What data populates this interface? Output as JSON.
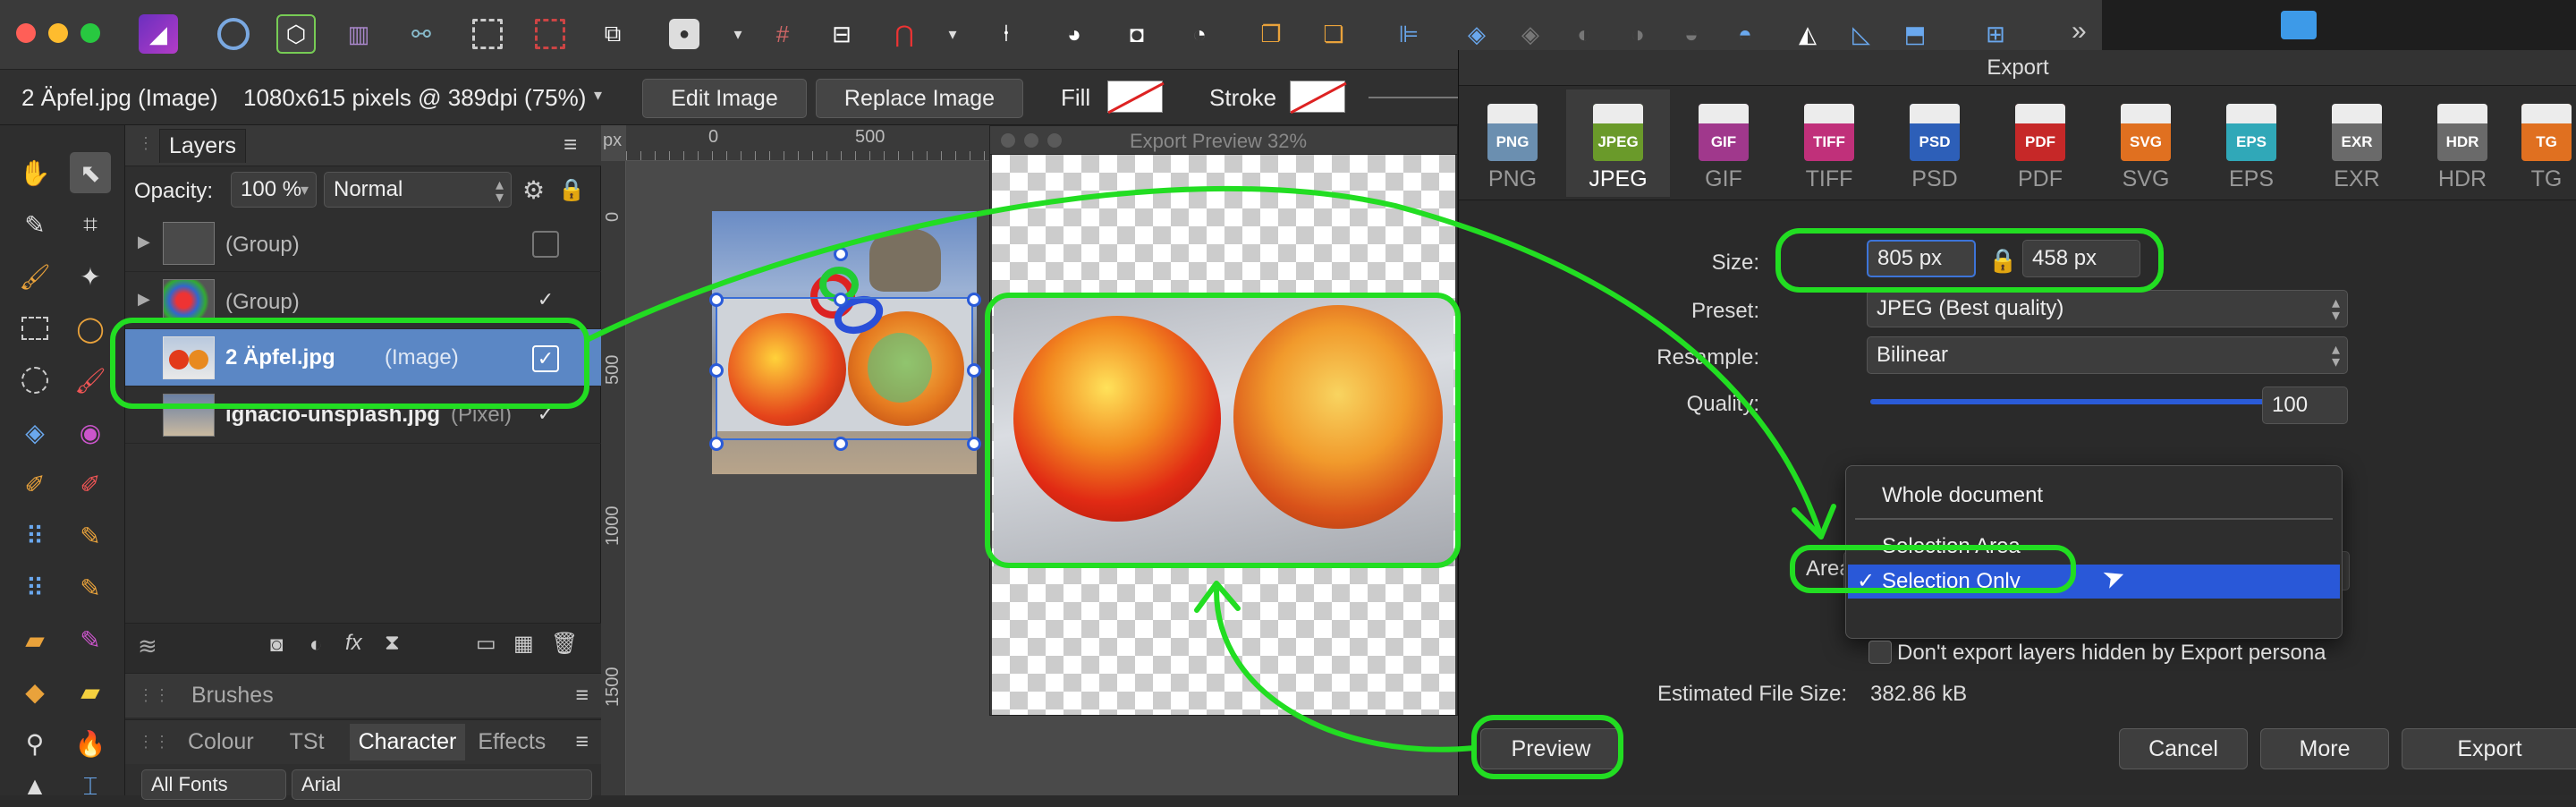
{
  "toolbar": {
    "icons": [
      "affinity-photo-icon",
      "color-wheel-icon",
      "persona-liquify-icon",
      "persona-develop-icon",
      "share-icon",
      "marquee-icon",
      "no-marquee-icon",
      "transform-icon",
      "mask-icon",
      "grid-icon",
      "align-icon",
      "snapping-magnet-icon",
      "pin-icon",
      "boolean-add-icon",
      "boolean-subtract-icon",
      "boolean-intersect-icon",
      "arrange-forward-icon",
      "arrange-back-icon",
      "align-left-icon",
      "flip-icon",
      "more-icon"
    ],
    "overflow": "»",
    "folder_icon": "folder-icon"
  },
  "context_bar": {
    "doc_name": "2 Äpfel.jpg (Image)",
    "doc_info": "1080x615 pixels @ 389dpi (75%)",
    "edit_image": "Edit Image",
    "replace_image": "Replace Image",
    "fill_label": "Fill",
    "stroke_label": "Stroke"
  },
  "layers_panel": {
    "tab": "Layers",
    "opacity_label": "Opacity:",
    "opacity_value": "100 %",
    "blend_mode": "Normal",
    "rows": [
      {
        "name": "(Group)",
        "kind": "",
        "checked": false
      },
      {
        "name": "(Group)",
        "kind": "",
        "checked": true
      },
      {
        "name": "2 Äpfel.jpg",
        "kind": "(Image)",
        "checked": true
      },
      {
        "name": "ignacio-unsplash.jpg",
        "kind": "(Pixel)",
        "checked": true
      }
    ]
  },
  "brushes_panel": {
    "title": "Brushes"
  },
  "bottom_tabs": {
    "tabs": [
      "Colour",
      "TSt",
      "Character",
      "Effects"
    ],
    "active": "Character"
  },
  "character": {
    "font_collection": "All Fonts",
    "font": "Arial"
  },
  "ruler": {
    "unit": "px",
    "top_ticks": [
      "0",
      "500"
    ],
    "left_ticks": [
      "0",
      "500",
      "1000",
      "1500"
    ]
  },
  "preview_window": {
    "title": "Export Preview 32%"
  },
  "export_dialog": {
    "title": "Export",
    "formats": [
      {
        "label": "PNG",
        "badge": "PNG",
        "color": "#6b8fb0"
      },
      {
        "label": "JPEG",
        "badge": "JPEG",
        "color": "#6a9a2a"
      },
      {
        "label": "GIF",
        "badge": "GIF",
        "color": "#a0388c"
      },
      {
        "label": "TIFF",
        "badge": "TIFF",
        "color": "#c0307a"
      },
      {
        "label": "PSD",
        "badge": "PSD",
        "color": "#2d5fb8"
      },
      {
        "label": "PDF",
        "badge": "PDF",
        "color": "#c62828"
      },
      {
        "label": "SVG",
        "badge": "SVG",
        "color": "#e07020"
      },
      {
        "label": "EPS",
        "badge": "EPS",
        "color": "#30a8b8"
      },
      {
        "label": "EXR",
        "badge": "EXR",
        "color": "#6a6a6a"
      },
      {
        "label": "HDR",
        "badge": "HDR",
        "color": "#6a6a6a"
      },
      {
        "label": "TG",
        "badge": "TG",
        "color": "#e07020"
      }
    ],
    "selected_format": "JPEG",
    "size_label": "Size:",
    "width": "805 px",
    "height": "458 px",
    "preset_label": "Preset:",
    "preset": "JPEG (Best quality)",
    "resample_label": "Resample:",
    "resample": "Bilinear",
    "quality_label": "Quality:",
    "quality": "100",
    "quality_fraction": 1.0,
    "area_label": "Area",
    "area_options": [
      "Whole document",
      "Selection Area",
      "Selection Only"
    ],
    "area_selected": "Selection Only",
    "checkmark": "✓",
    "dont_export_hidden": "Don't export layers hidden by Export persona",
    "est_size_label": "Estimated File Size:",
    "est_size": "382.86 kB",
    "preview_button": "Preview",
    "cancel_button": "Cancel",
    "more_button": "More",
    "export_button": "Export"
  },
  "colors": {
    "accent": "#2958d8",
    "annotation": "#22dd22",
    "selected_layer": "#5b87c5"
  }
}
